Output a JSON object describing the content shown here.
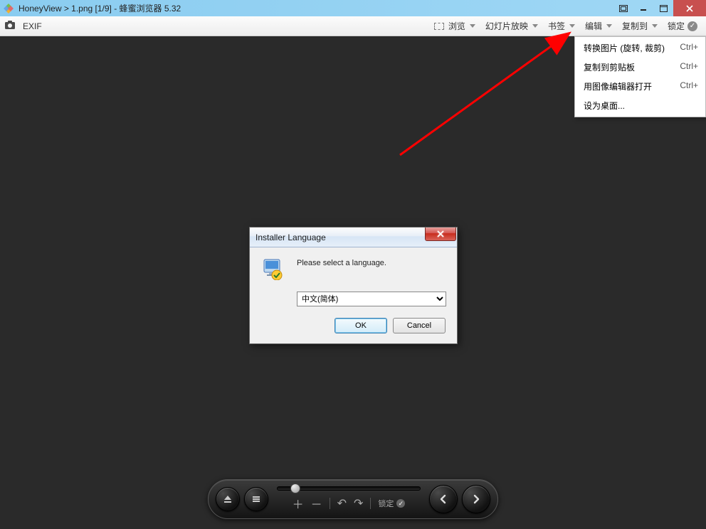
{
  "titlebar": {
    "text": "HoneyView > 1.png [1/9] - 蜂蜜浏览器 5.32"
  },
  "toolbar": {
    "exif_label": "EXIF",
    "items": {
      "browse": "浏览",
      "slideshow": "幻灯片放映",
      "bookmark": "书签",
      "edit": "编辑",
      "copyto": "复制到",
      "lock": "锁定"
    }
  },
  "dropdown": {
    "items": [
      {
        "label": "转换图片 (旋转, 裁剪)",
        "shortcut": "Ctrl+"
      },
      {
        "label": "复制到剪贴板",
        "shortcut": "Ctrl+"
      },
      {
        "label": "用图像编辑器打开",
        "shortcut": "Ctrl+"
      },
      {
        "label": "设为桌面...",
        "shortcut": ""
      }
    ]
  },
  "dialog": {
    "title": "Installer Language",
    "message": "Please select a language.",
    "selected": "中文(简体)",
    "ok": "OK",
    "cancel": "Cancel"
  },
  "controlbar": {
    "lock_label": "锁定"
  }
}
